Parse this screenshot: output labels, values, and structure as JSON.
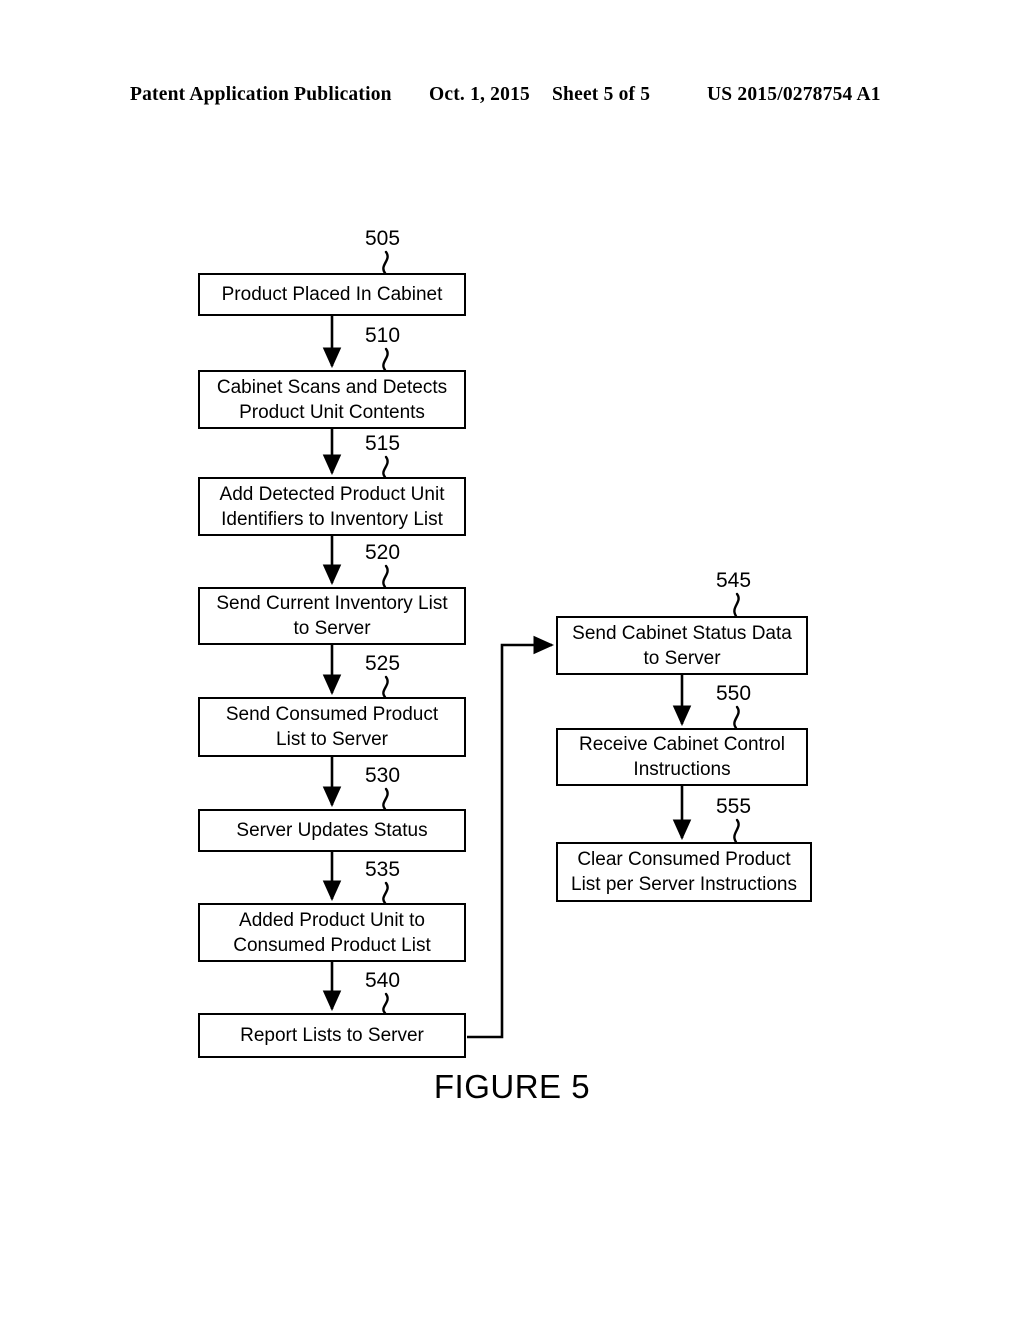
{
  "header": {
    "publication": "Patent Application Publication",
    "date": "Oct. 1, 2015",
    "sheet": "Sheet 5 of 5",
    "patent_number": "US 2015/0278754 A1"
  },
  "figure": {
    "caption": "FIGURE 5",
    "line_color": "#000000",
    "fill_color": "#ffffff"
  },
  "flowchart": {
    "nodes": [
      {
        "ref": "505",
        "text": "Product Placed In Cabinet"
      },
      {
        "ref": "510",
        "text": "Cabinet Scans and Detects\nProduct Unit Contents"
      },
      {
        "ref": "515",
        "text": "Add Detected Product Unit\nIdentifiers to Inventory List"
      },
      {
        "ref": "520",
        "text": "Send Current Inventory List\nto Server"
      },
      {
        "ref": "525",
        "text": "Send Consumed Product\nList to Server"
      },
      {
        "ref": "530",
        "text": "Server Updates Status"
      },
      {
        "ref": "535",
        "text": "Added Product Unit to\nConsumed Product List"
      },
      {
        "ref": "540",
        "text": "Report Lists to Server"
      },
      {
        "ref": "545",
        "text": "Send Cabinet Status Data\nto Server"
      },
      {
        "ref": "550",
        "text": "Receive Cabinet Control\nInstructions"
      },
      {
        "ref": "555",
        "text": "Clear Consumed Product\nList per Server Instructions"
      }
    ]
  }
}
